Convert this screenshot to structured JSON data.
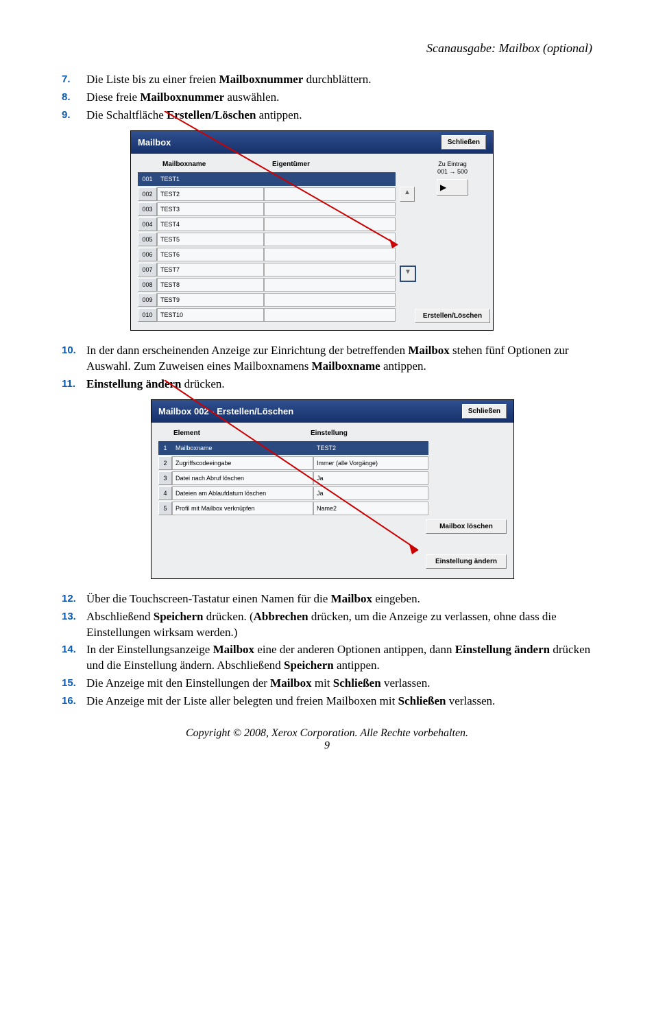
{
  "header": "Scanausgabe: Mailbox (optional)",
  "steps": {
    "s7": {
      "num": "7.",
      "a": "Die Liste bis zu einer freien ",
      "b": "Mailboxnummer",
      "c": " durchblättern."
    },
    "s8": {
      "num": "8.",
      "a": "Diese freie ",
      "b": "Mailboxnummer",
      "c": " auswählen."
    },
    "s9": {
      "num": "9.",
      "a": "Die Schaltfläche ",
      "b": "Erstellen/Löschen",
      "c": " antippen."
    },
    "s10": {
      "num": "10.",
      "a": "In der dann erscheinenden Anzeige zur Einrichtung der betreffenden ",
      "b": "Mailbox",
      "c": " stehen fünf Optionen zur Auswahl. Zum Zuweisen eines Mailboxnamens ",
      "d": "Mailboxname",
      "e": " antippen."
    },
    "s11": {
      "num": "11.",
      "b": "Einstellung ändern",
      "c": " drücken."
    },
    "s12": {
      "num": "12.",
      "a": "Über die Touchscreen-Tastatur einen Namen für die ",
      "b": "Mailbox",
      "c": " eingeben."
    },
    "s13": {
      "num": "13.",
      "a": "Abschließend ",
      "b": "Speichern",
      "c": " drücken. (",
      "d": "Abbrechen",
      "e": " drücken, um die Anzeige zu verlassen, ohne dass die Einstellungen wirksam werden.)"
    },
    "s14": {
      "num": "14.",
      "a": "In der Einstellungsanzeige ",
      "b": "Mailbox",
      "c": " eine der anderen Optionen antippen, dann ",
      "d": "Einstellung ändern",
      "e": " drücken und die Einstellung ändern. Abschließend ",
      "f": "Speichern",
      "g": " antippen."
    },
    "s15": {
      "num": "15.",
      "a": "Die Anzeige mit den Einstellungen der ",
      "b": "Mailbox",
      "c": " mit ",
      "d": "Schließen",
      "e": " verlassen."
    },
    "s16": {
      "num": "16.",
      "a": "Die Anzeige mit der Liste aller belegten und freien Mailboxen mit ",
      "b": "Schließen",
      "c": " verlassen."
    }
  },
  "fig1": {
    "title": "Mailbox",
    "close": "Schließen",
    "col_name": "Mailboxname",
    "col_owner": "Eigentümer",
    "goto1": "Zu Eintrag",
    "goto2": "001 → 500",
    "create": "Erstellen/Löschen",
    "rows": [
      {
        "n": "001",
        "name": "TEST1"
      },
      {
        "n": "002",
        "name": "TEST2"
      },
      {
        "n": "003",
        "name": "TEST3"
      },
      {
        "n": "004",
        "name": "TEST4"
      },
      {
        "n": "005",
        "name": "TEST5"
      },
      {
        "n": "006",
        "name": "TEST6"
      },
      {
        "n": "007",
        "name": "TEST7"
      },
      {
        "n": "008",
        "name": "TEST8"
      },
      {
        "n": "009",
        "name": "TEST9"
      },
      {
        "n": "010",
        "name": "TEST10"
      }
    ]
  },
  "fig2": {
    "title": "Mailbox 002 - Erstellen/Löschen",
    "close": "Schließen",
    "col_elem": "Element",
    "col_set": "Einstellung",
    "del": "Mailbox löschen",
    "change": "Einstellung ändern",
    "rows": [
      {
        "n": "1",
        "e": "Mailboxname",
        "v": "TEST2"
      },
      {
        "n": "2",
        "e": "Zugriffscodeeingabe",
        "v": "Immer (alle Vorgänge)"
      },
      {
        "n": "3",
        "e": "Datei nach Abruf löschen",
        "v": "Ja"
      },
      {
        "n": "4",
        "e": "Dateien am Ablaufdatum löschen",
        "v": "Ja"
      },
      {
        "n": "5",
        "e": "Profil mit Mailbox verknüpfen",
        "v": "Name2"
      }
    ]
  },
  "footer": "Copyright © 2008, Xerox Corporation. Alle Rechte vorbehalten.",
  "page": "9"
}
